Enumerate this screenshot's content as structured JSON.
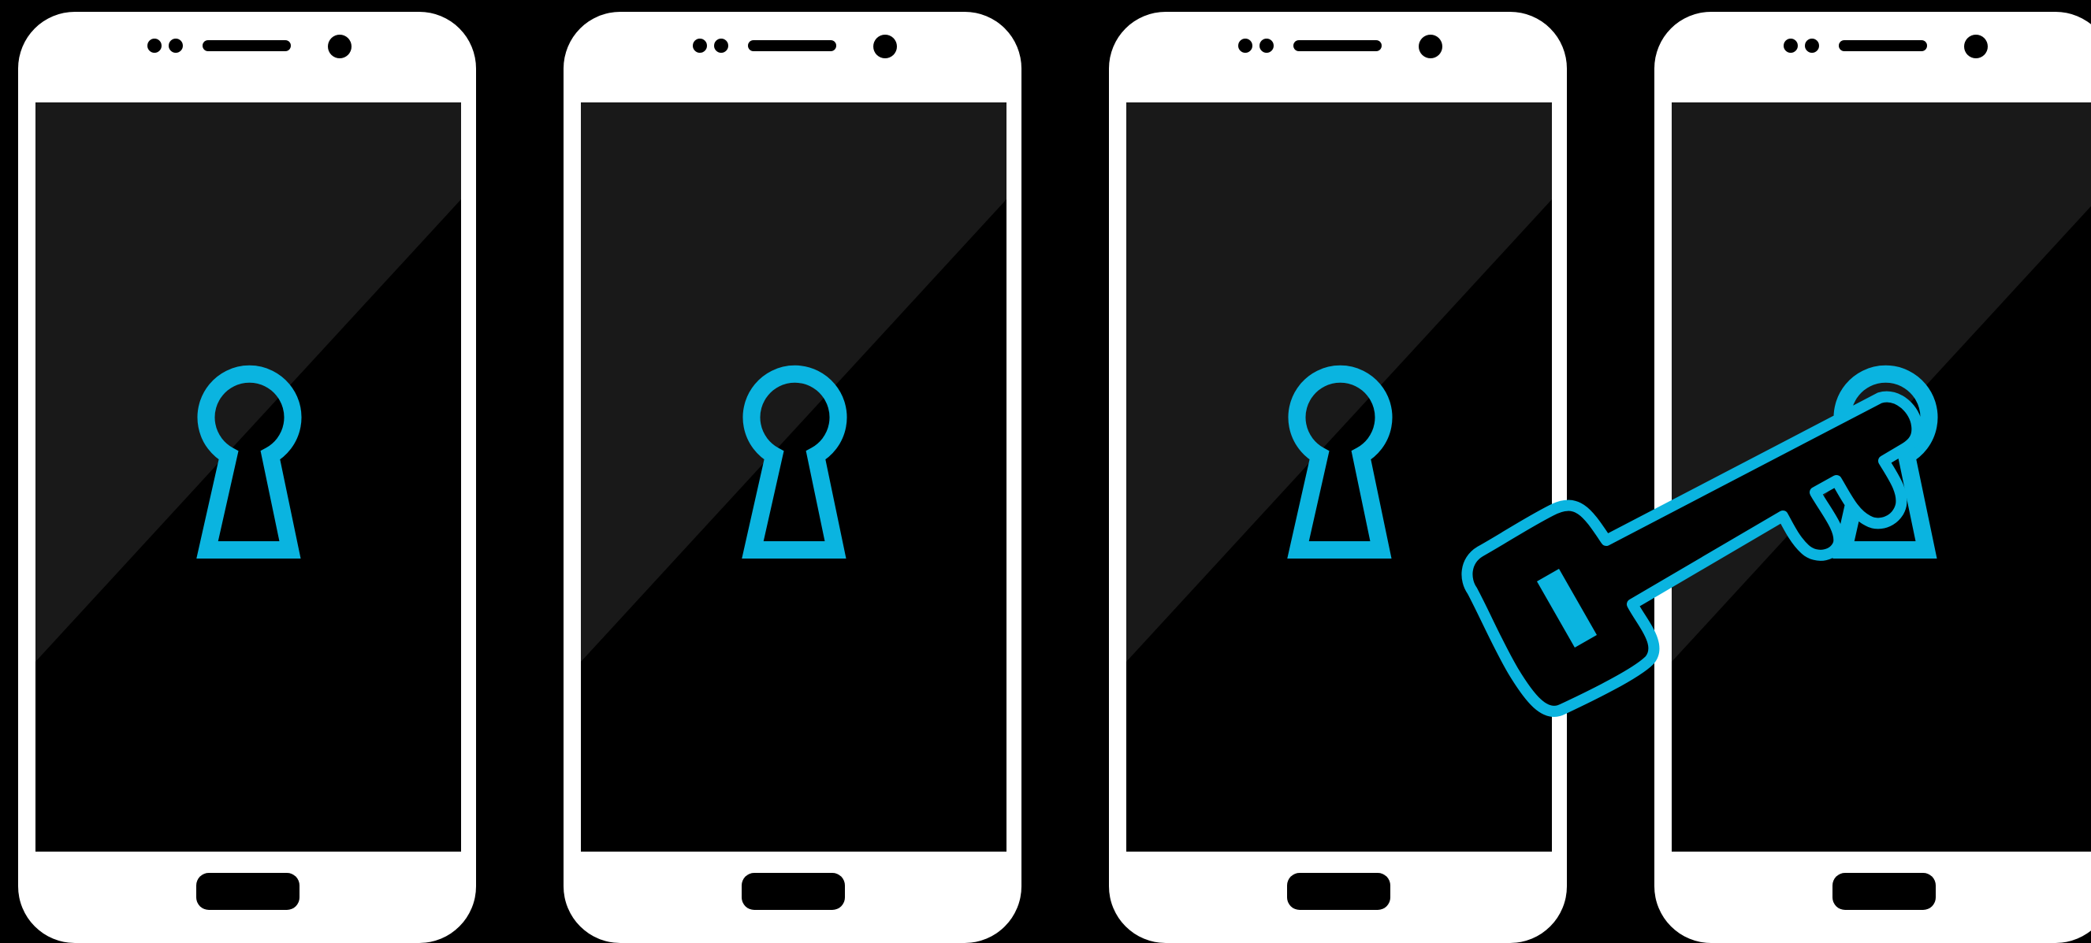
{
  "colors": {
    "background": "#000000",
    "phone_body": "#ffffff",
    "screen": "#000000",
    "screen_glare": "#191919",
    "accent": "#0ab4e0",
    "hardware_details": "#000000"
  },
  "phones": [
    {
      "label": "phone-1",
      "screen_icon": "keyhole-icon"
    },
    {
      "label": "phone-2",
      "screen_icon": "keyhole-icon"
    },
    {
      "label": "phone-3",
      "screen_icon": "keyhole-icon"
    },
    {
      "label": "phone-4",
      "screen_icon": "keyhole-icon"
    }
  ],
  "overlay_icon": "key-icon"
}
